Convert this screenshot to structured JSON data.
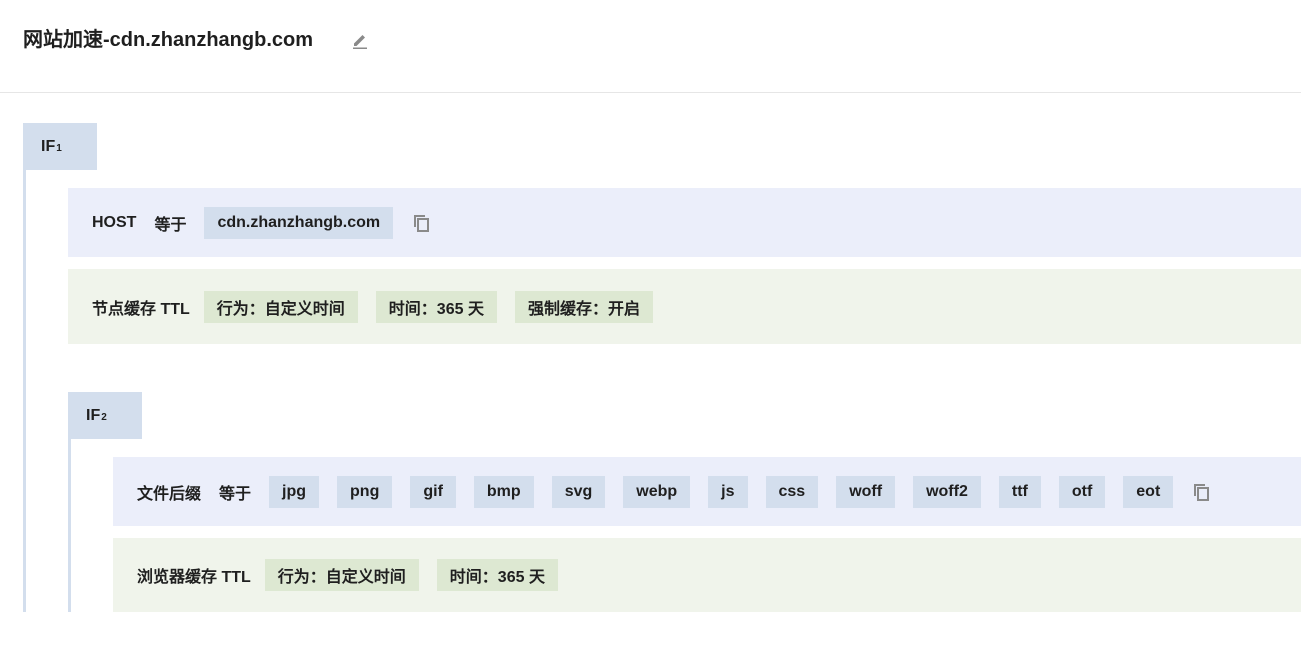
{
  "header": {
    "title": "网站加速-cdn.zhanzhangb.com"
  },
  "rules": {
    "if1": {
      "label": "IF",
      "index": "1",
      "condition": {
        "field": "HOST",
        "operator": "等于",
        "values": [
          "cdn.zhanzhangb.com"
        ]
      },
      "action": {
        "name": "节点缓存 TTL",
        "params": [
          "行为：自定义时间",
          "时间：365 天",
          "强制缓存：开启"
        ]
      }
    },
    "if2": {
      "label": "IF",
      "index": "2",
      "condition": {
        "field": "文件后缀",
        "operator": "等于",
        "values": [
          "jpg",
          "png",
          "gif",
          "bmp",
          "svg",
          "webp",
          "js",
          "css",
          "woff",
          "woff2",
          "ttf",
          "otf",
          "eot"
        ]
      },
      "action": {
        "name": "浏览器缓存 TTL",
        "params": [
          "行为：自定义时间",
          "时间：365 天"
        ]
      }
    }
  },
  "icons": {
    "edit": "edit-icon",
    "copy": "copy-icon"
  },
  "colors": {
    "if_label_bg": "#d3deed",
    "condition_bg": "#ebeefa",
    "action_bg": "#f0f4eb"
  }
}
